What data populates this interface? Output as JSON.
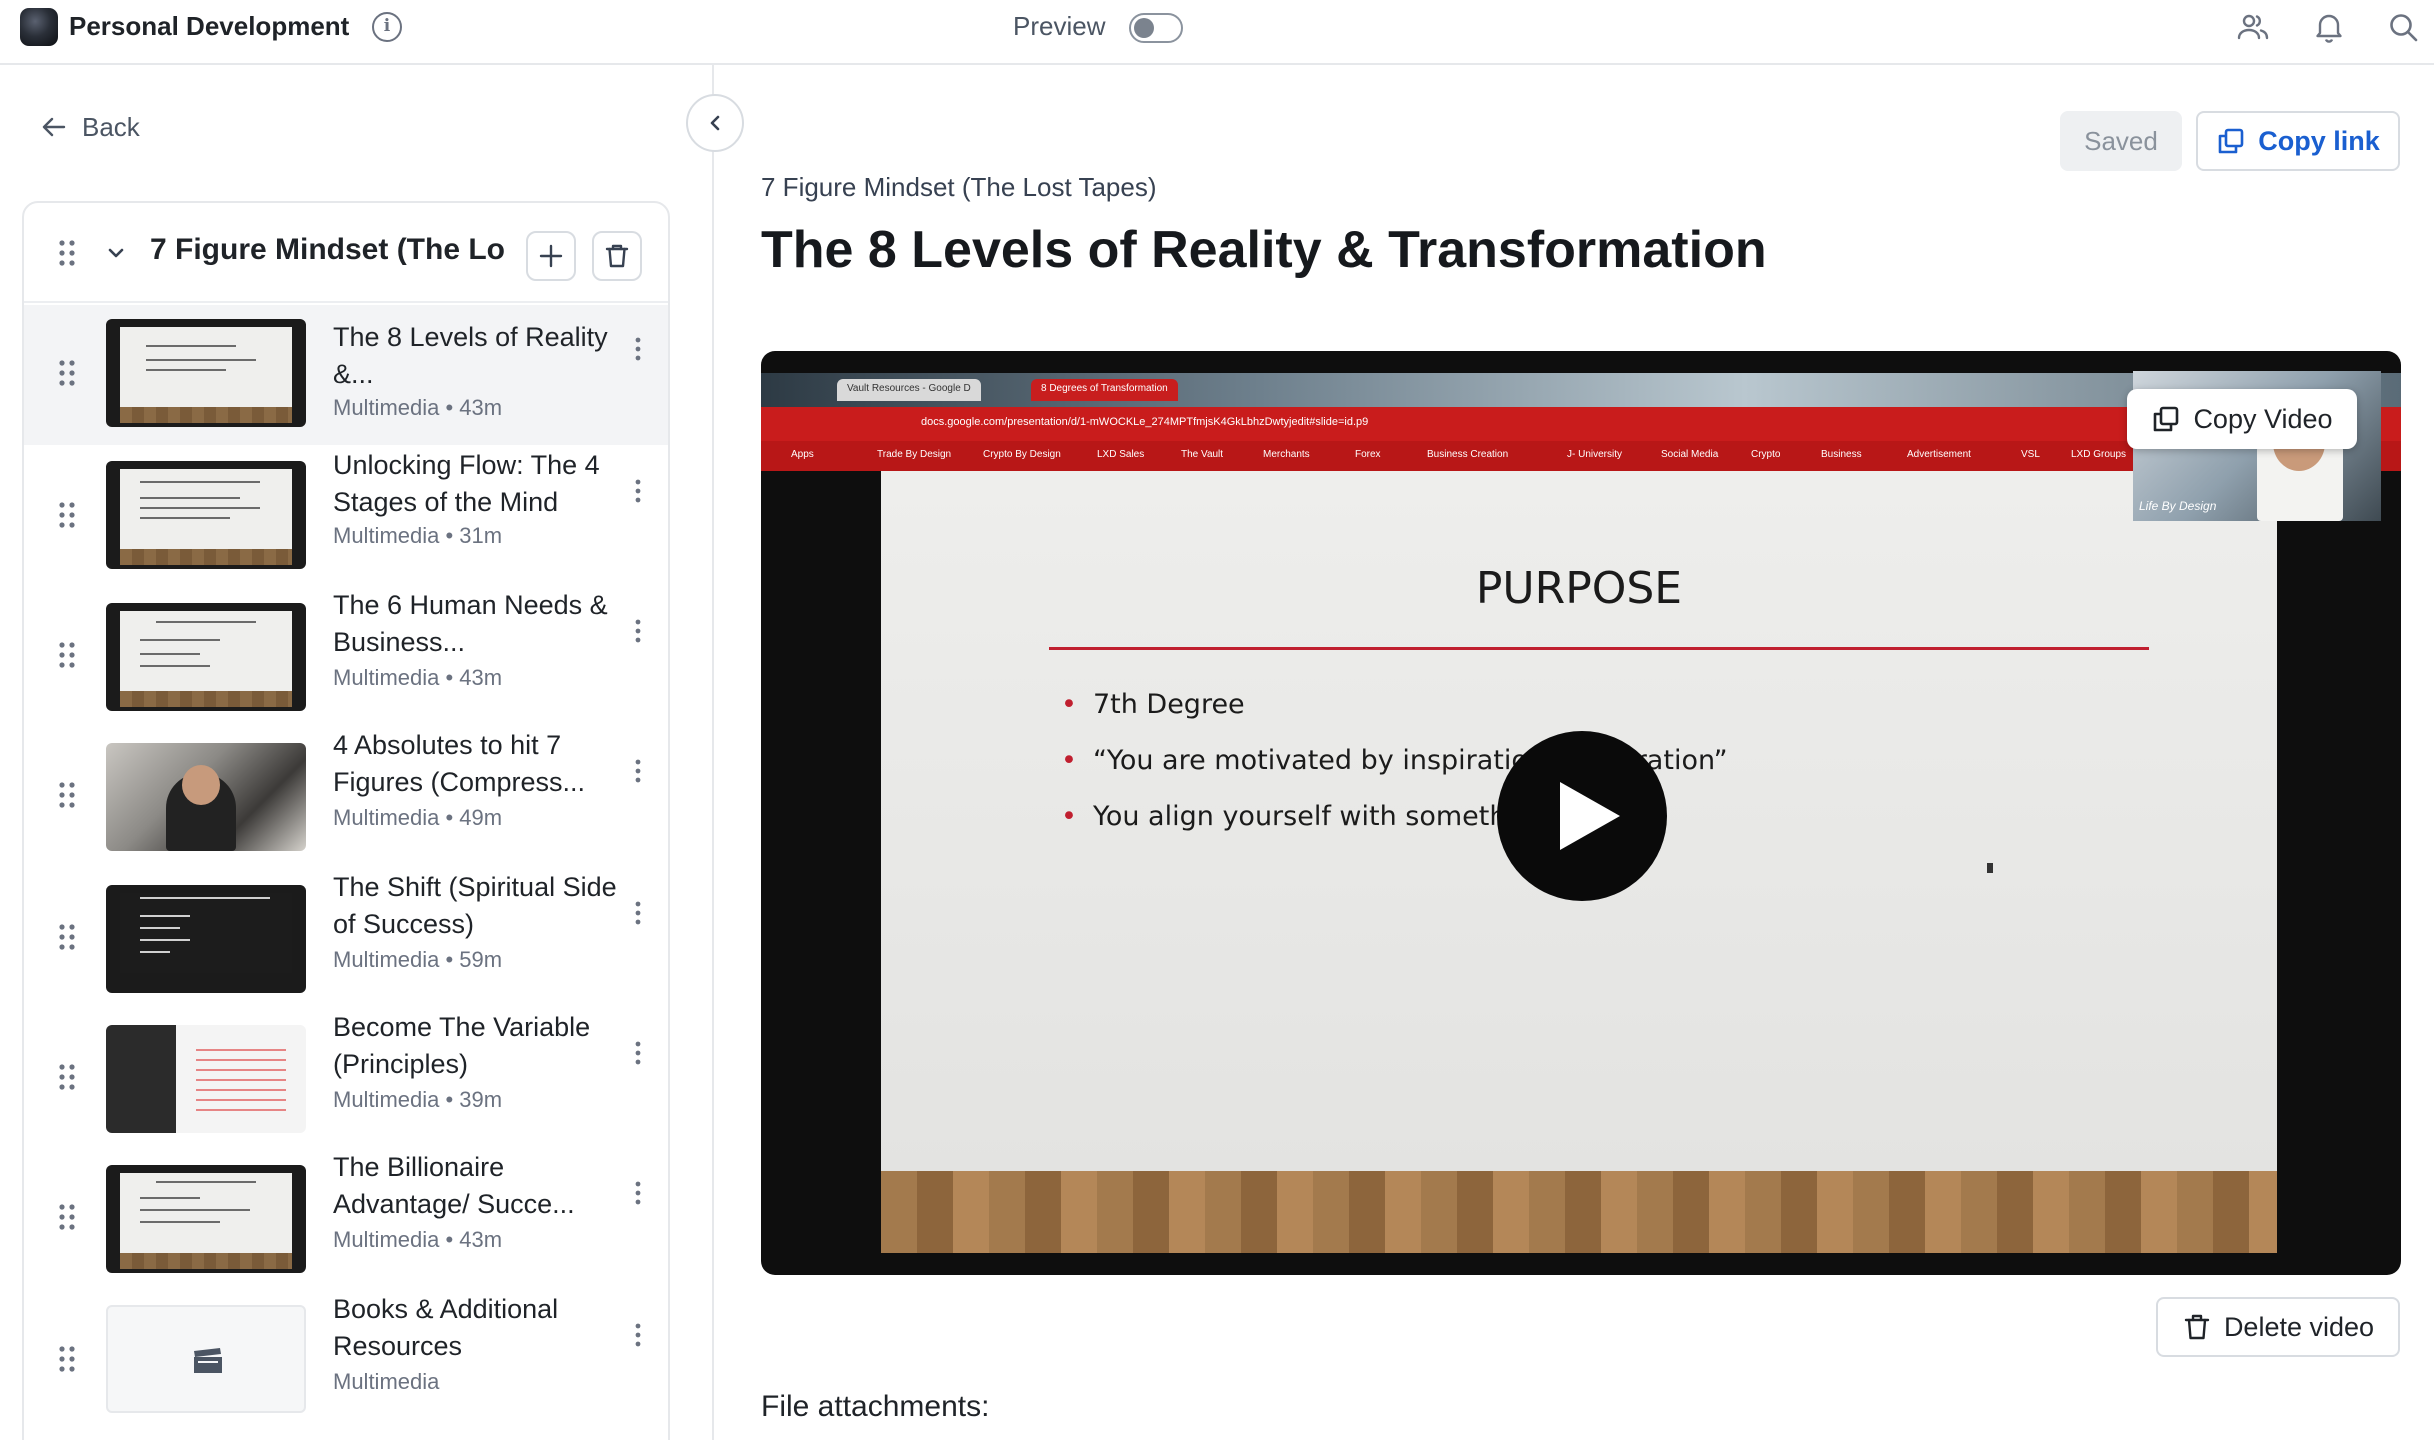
{
  "app": {
    "title": "Personal Development",
    "preview_label": "Preview",
    "preview_enabled": false,
    "logo": "app-logo",
    "info_icon": "info-icon"
  },
  "topbar_icons": [
    "users-icon",
    "bell-icon",
    "search-icon"
  ],
  "sidebar": {
    "back_label": "Back",
    "module": {
      "title": "7 Figure Mindset (The Lo",
      "lessons": [
        {
          "title": "The 8 Levels of Reality &...",
          "meta": "Multimedia • 43m",
          "active": true,
          "thumb": "slide"
        },
        {
          "title": "Unlocking Flow: The 4 Stages of the Mind",
          "meta": "Multimedia • 31m",
          "active": false,
          "thumb": "slide"
        },
        {
          "title": "The 6 Human Needs & Business...",
          "meta": "Multimedia • 43m",
          "active": false,
          "thumb": "slide"
        },
        {
          "title": "4 Absolutes to hit 7 Figures (Compress...",
          "meta": "Multimedia • 49m",
          "active": false,
          "thumb": "photo"
        },
        {
          "title": "The Shift (Spiritual Side of Success)",
          "meta": "Multimedia • 59m",
          "active": false,
          "thumb": "dark"
        },
        {
          "title": "Become The Variable (Principles)",
          "meta": "Multimedia • 39m",
          "active": false,
          "thumb": "board"
        },
        {
          "title": "The Billionaire Advantage/ Succe...",
          "meta": "Multimedia • 43m",
          "active": false,
          "thumb": "slide"
        },
        {
          "title": "Books & Additional Resources",
          "meta": "Multimedia",
          "active": false,
          "thumb": "empty"
        }
      ]
    }
  },
  "main": {
    "saved_label": "Saved",
    "copy_link_label": "Copy link",
    "breadcrumb": "7 Figure Mindset (The Lost Tapes)",
    "title": "The 8 Levels of Reality & Transformation",
    "video": {
      "copy_video_label": "Copy Video",
      "browser_tabs": [
        "Vault Resources - Google D",
        "8 Degrees of Transformation"
      ],
      "url": "docs.google.com/presentation/d/1-mWOCKLe_274MPTfmjsK4GkLbhzDwtyjedit#slide=id.p9",
      "bookmarks": [
        "Apps",
        "Trade By Design",
        "Crypto By Design",
        "LXD Sales",
        "The Vault",
        "Merchants",
        "Forex",
        "Business Creation",
        "J- University",
        "Social Media",
        "Crypto",
        "Business",
        "Advertisement",
        "VSL",
        "LXD Groups"
      ],
      "slide_title": "PURPOSE",
      "slide_bullets": [
        "7th Degree",
        "“You are motivated by inspiration, n                 speration”",
        "You align yourself with something b                        u."
      ],
      "cam_label": "Life By Design"
    },
    "delete_video_label": "Delete video",
    "attachments_label": "File attachments:"
  },
  "colors": {
    "accent": "#1a5fd0",
    "border": "#d8dce1",
    "active_row": "#f3f4f6",
    "slide_red": "#c01f2f"
  }
}
